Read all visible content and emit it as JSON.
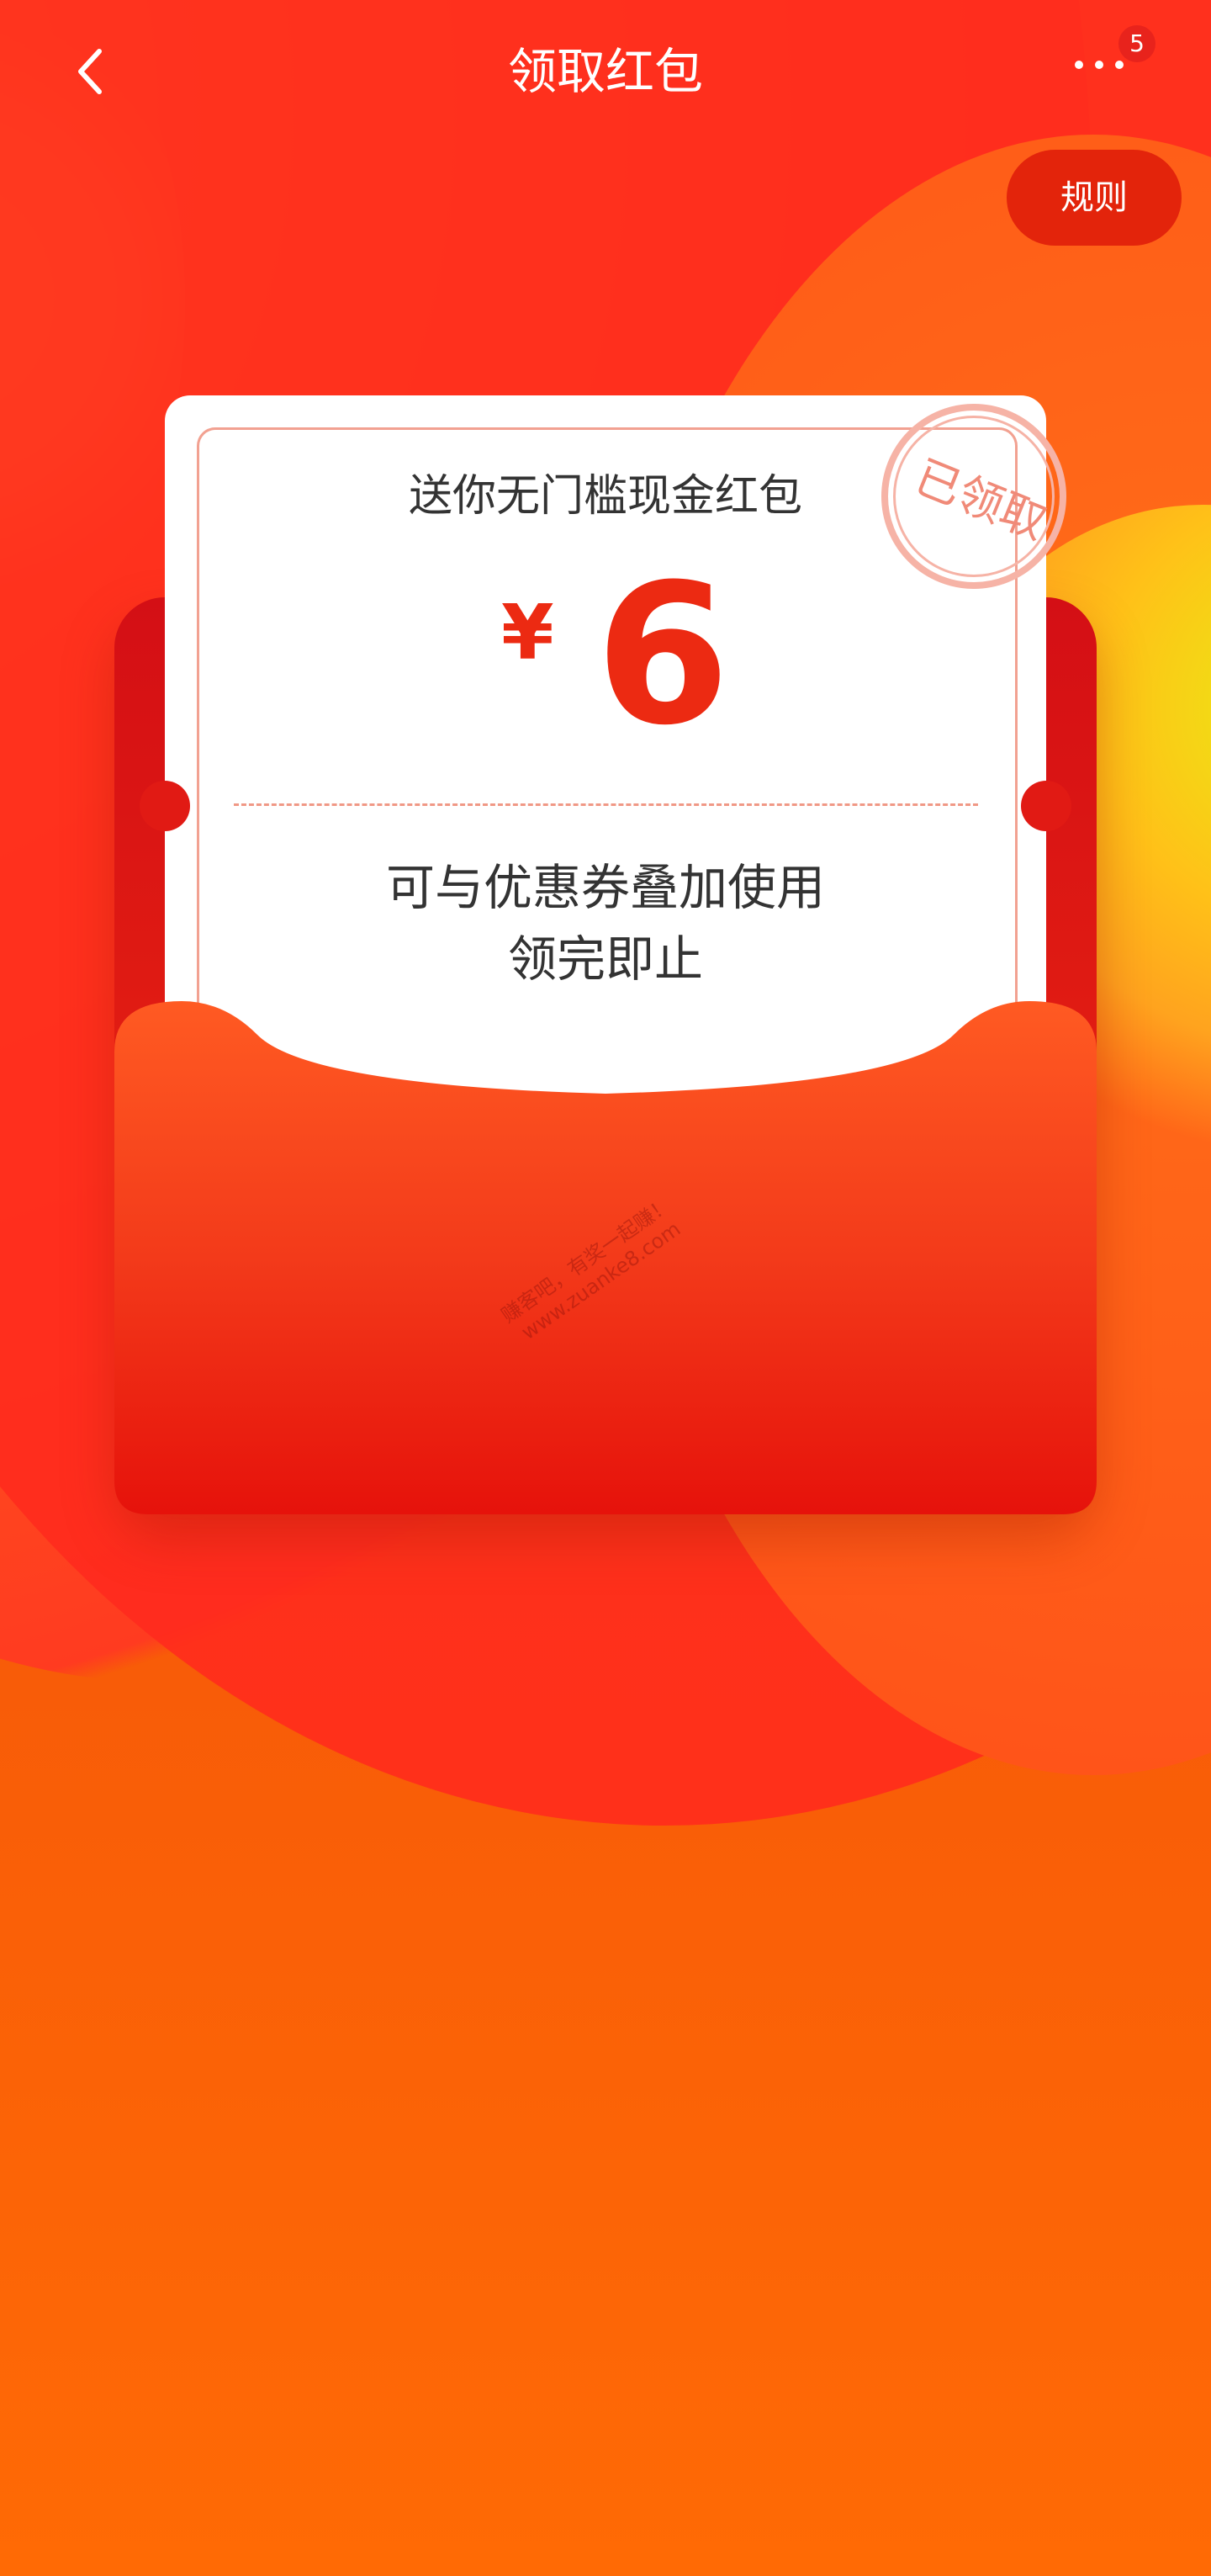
{
  "header": {
    "title": "领取红包",
    "back_icon": "chevron-left-icon",
    "more_icon": "more-dots-icon",
    "notification_count": "5"
  },
  "rules_button": {
    "label": "规则"
  },
  "red_packet": {
    "title": "送你无门槛现金红包",
    "currency": "¥",
    "amount": "6",
    "description_line1": "可与优惠券叠加使用",
    "description_line2": "领完即止",
    "stamp_text": "已领取"
  },
  "watermark": {
    "line1": "赚客吧，有奖一起赚！",
    "line2": "www.zuanke8.com"
  },
  "colors": {
    "accent": "#ec2a12",
    "badge": "#e8231c",
    "rules_bg": "#e3240b",
    "envelope": "#e41f12"
  }
}
